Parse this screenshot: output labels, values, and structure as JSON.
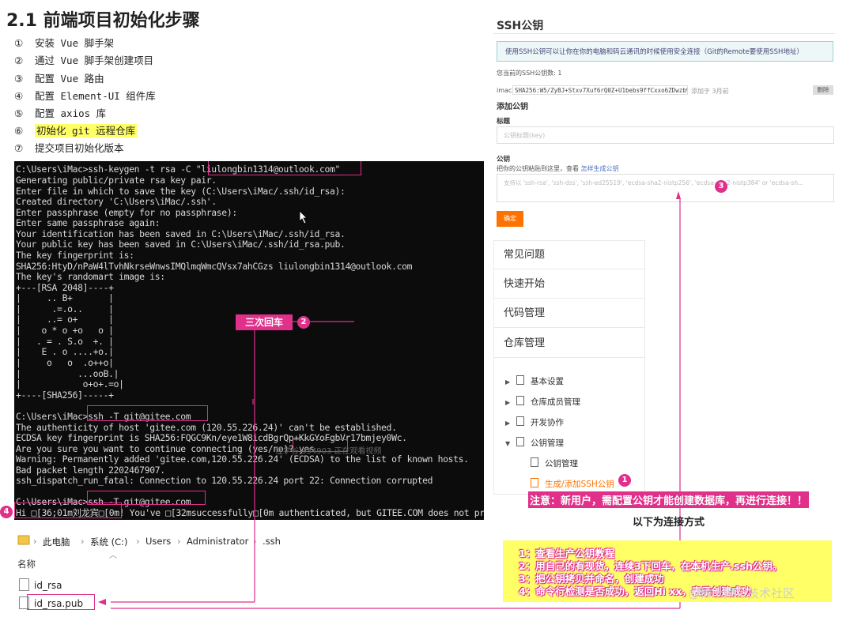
{
  "title": "2.1 前端项目初始化步骤",
  "steps": [
    {
      "num": "①",
      "text": "安装 Vue 脚手架"
    },
    {
      "num": "②",
      "text": "通过 Vue 脚手架创建项目"
    },
    {
      "num": "③",
      "text": "配置 Vue 路由"
    },
    {
      "num": "④",
      "text": "配置 Element-UI 组件库"
    },
    {
      "num": "⑤",
      "text": "配置 axios 库"
    },
    {
      "num": "⑥",
      "text": "初始化 git 远程仓库"
    },
    {
      "num": "⑦",
      "text": "提交项目初始化版本"
    }
  ],
  "terminal": {
    "lines": [
      "C:\\Users\\iMac>ssh-keygen -t rsa -C \"liulongbin1314@outlook.com\"",
      "Generating public/private rsa key pair.",
      "Enter file in which to save the key (C:\\Users\\iMac/.ssh/id_rsa):",
      "Created directory 'C:\\Users\\iMac/.ssh'.",
      "Enter passphrase (empty for no passphrase):",
      "Enter same passphrase again:",
      "Your identification has been saved in C:\\Users\\iMac/.ssh/id_rsa.",
      "Your public key has been saved in C:\\Users\\iMac/.ssh/id_rsa.pub.",
      "The key fingerprint is:",
      "SHA256:HtyD/nPaW4lTvhNkrseWnwsIMQlmqWmcQVsx7ahCGzs liulongbin1314@outlook.com",
      "The key's randomart image is:",
      "+---[RSA 2048]----+",
      "|     .. B+       |",
      "|      .=.o..     |",
      "|     ..= o+      |",
      "|    o * o +o   o |",
      "|   . = . S.o  +. |",
      "|    E . o ....+o.|",
      "|     o   o  .o++o|",
      "|           ...ooB.|",
      "|            o+o+.=o|",
      "+----[SHA256]-----+",
      "",
      "C:\\Users\\iMac>ssh -T git@gitee.com",
      "The authenticity of host 'gitee.com (120.55.226.24)' can't be established.",
      "ECDSA key fingerprint is SHA256:FQGC9Kn/eye1W8icdBgrQp+KkGYoFgbVr17bmjey0Wc.",
      "Are you sure you want to continue connecting (yes/no)? yes",
      "Warning: Permanently added 'gitee.com,120.55.226.24' (ECDSA) to the list of known hosts.",
      "Bad packet length 2202467907.",
      "ssh_dispatch_run_fatal: Connection to 120.55.226.24 port 22: Connection corrupted",
      "",
      "C:\\Users\\iMac>ssh -T git@gitee.com",
      "Hi \u001b[36;01m刘龙宾\u001b[0m! You've \u001b[32msuccessfully\u001b[0m authenticated, but GITEE.COM does not provide shell access."
    ],
    "watermark": "懂学谷 334903 正在观看视频"
  },
  "explorer": {
    "breadcrumb": [
      "此电脑",
      "系统 (C:)",
      "Users",
      "Administrator",
      ".ssh"
    ],
    "column_header": "名称",
    "files": [
      "id_rsa",
      "id_rsa.pub"
    ]
  },
  "ssh_panel": {
    "title": "SSH公钥",
    "info": "使用SSH公钥可以让你在你的电脑和码云通讯的时候使用安全连接（Git的Remote要使用SSH地址）",
    "count_text": "您当前的SSH公钥数: 1",
    "key_name": "imac",
    "key_value": "SHA256:W5/ZyBJ+Stxv7Xuf6rQ0Z+U1bebs9ffCxxo6ZDwzb90",
    "key_added": "添加于 3月前",
    "delete_label": "删除",
    "add_heading": "添加公钥",
    "title_label": "标题",
    "title_placeholder": "公钥标题(key)",
    "key_label": "公钥",
    "key_hint": "把你的公钥粘贴到这里，查看",
    "key_hint_link": "怎样生成公钥",
    "key_placeholder": "支持以 'ssh-rsa', 'ssh-dss', 'ssh-ed25519', 'ecdsa-sha2-nistp256', 'ecdsa-sha2-nistp384' or 'ecdsa-sh...",
    "confirm_label": "确定"
  },
  "help_menu": {
    "sections": [
      "常见问题",
      "快速开始",
      "代码管理",
      "仓库管理"
    ],
    "items": [
      {
        "label": "基本设置",
        "expanded": false
      },
      {
        "label": "仓库成员管理",
        "expanded": false
      },
      {
        "label": "开发协作",
        "expanded": false
      },
      {
        "label": "公钥管理",
        "expanded": true
      }
    ],
    "subitems": [
      "公钥管理",
      "生成/添加SSH公钥"
    ]
  },
  "annotations": {
    "enter_three": "三次回车",
    "notice": "注意：新用户，需配置公钥才能创建数据库，再进行连接！！",
    "method": "以下为连接方式",
    "steps": [
      "1：查看生产公钥教程",
      "2：用自己的有现货，连续3下回车，在本机生产.ssh公钥。",
      "3：把公钥拷贝并命名，创建成功",
      "4：命令行检测是否成功，返回Hi xx，表示创建成功"
    ],
    "badges": [
      "1",
      "2",
      "3",
      "4"
    ],
    "watermark": "@稀土掘金技术社区",
    "accent_color": "#e0308a",
    "highlight_color": "#ffff66"
  }
}
